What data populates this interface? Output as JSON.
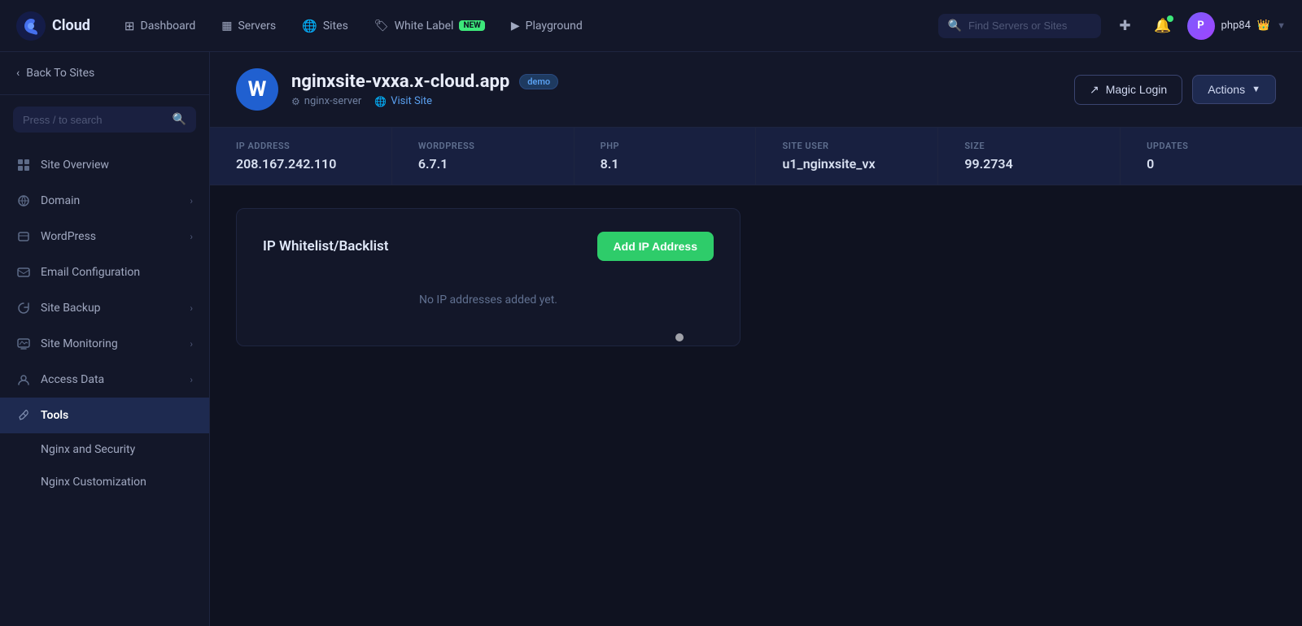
{
  "topnav": {
    "logo_text": "Cloud",
    "nav_items": [
      {
        "label": "Dashboard",
        "icon": "grid-icon"
      },
      {
        "label": "Servers",
        "icon": "server-icon"
      },
      {
        "label": "Sites",
        "icon": "globe-icon"
      },
      {
        "label": "White Label",
        "icon": "tag-icon",
        "badge": "NEW"
      },
      {
        "label": "Playground",
        "icon": "play-icon"
      }
    ],
    "search_placeholder": "Find Servers or Sites",
    "user_name": "php84",
    "user_initials": "P"
  },
  "sidebar": {
    "back_label": "Back To Sites",
    "search_placeholder": "Press / to search",
    "menu_items": [
      {
        "label": "Site Overview",
        "icon": "overview-icon",
        "has_chevron": false
      },
      {
        "label": "Domain",
        "icon": "domain-icon",
        "has_chevron": true
      },
      {
        "label": "WordPress",
        "icon": "wordpress-icon",
        "has_chevron": true
      },
      {
        "label": "Email Configuration",
        "icon": "email-icon",
        "has_chevron": false
      },
      {
        "label": "Site Backup",
        "icon": "backup-icon",
        "has_chevron": true
      },
      {
        "label": "Site Monitoring",
        "icon": "monitoring-icon",
        "has_chevron": true
      },
      {
        "label": "Access Data",
        "icon": "access-icon",
        "has_chevron": true
      },
      {
        "label": "Tools",
        "icon": "tools-icon",
        "has_chevron": false,
        "active": true
      }
    ],
    "sub_items": [
      {
        "label": "Nginx and Security"
      },
      {
        "label": "Nginx Customization"
      }
    ]
  },
  "site": {
    "name": "nginxsite-vxxa.x-cloud.app",
    "badge": "demo",
    "server": "nginx-server",
    "visit_site_label": "Visit Site",
    "magic_login_label": "Magic Login",
    "actions_label": "Actions"
  },
  "stats": [
    {
      "label": "IP ADDRESS",
      "value": "208.167.242.110"
    },
    {
      "label": "WORDPRESS",
      "value": "6.7.1"
    },
    {
      "label": "PHP",
      "value": "8.1"
    },
    {
      "label": "SITE USER",
      "value": "u1_nginxsite_vx"
    },
    {
      "label": "SIZE",
      "value": "99.2734"
    },
    {
      "label": "UPDATES",
      "value": "0"
    }
  ],
  "ip_whitelist": {
    "title": "IP Whitelist/Backlist",
    "add_button_label": "Add IP Address",
    "empty_message": "No IP addresses added yet."
  }
}
